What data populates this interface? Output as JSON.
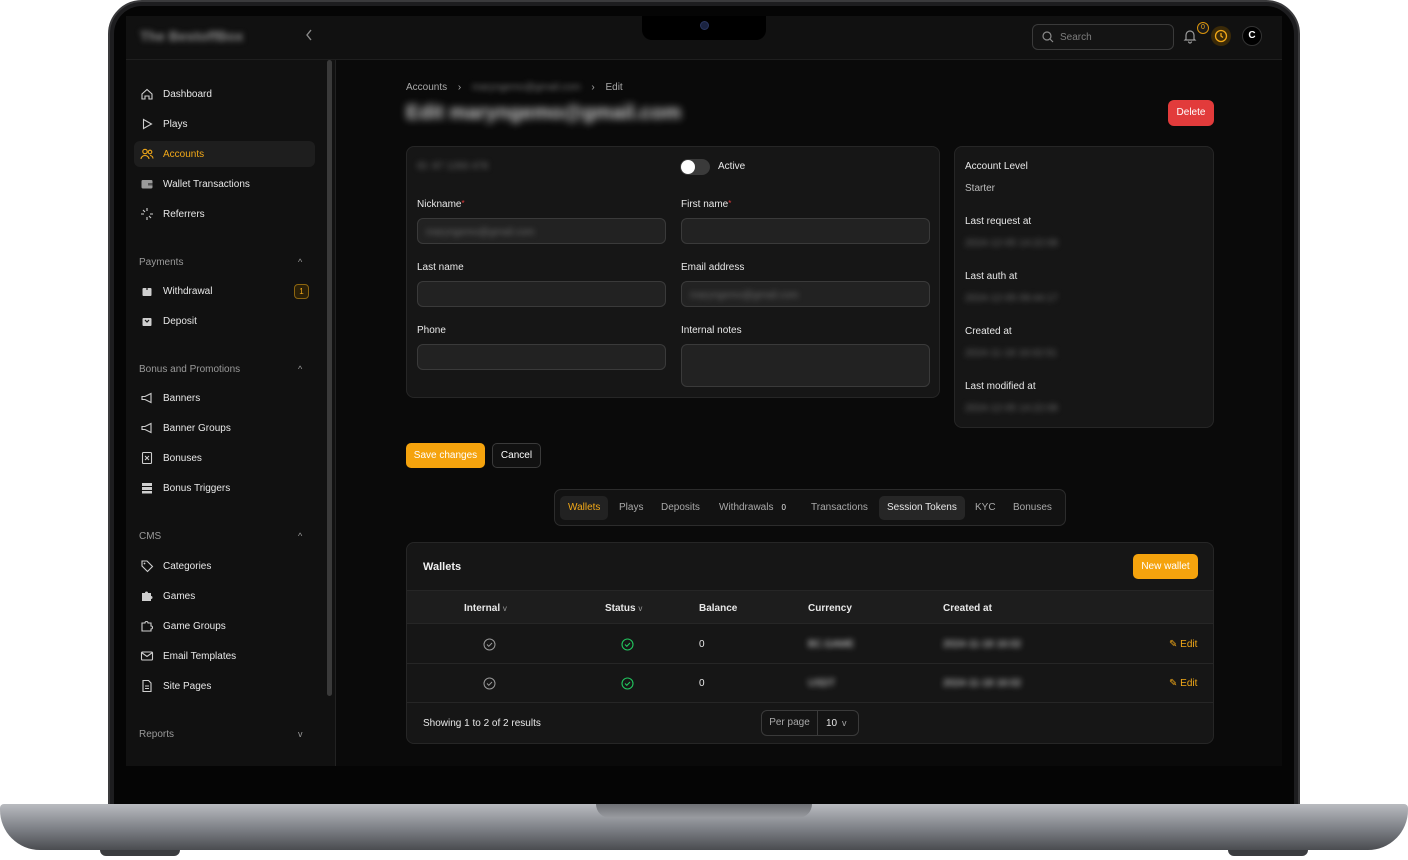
{
  "topbar": {
    "brand": "The BestoffBox",
    "search_placeholder": "Search",
    "notifications_count": "0",
    "avatar_initial": "C"
  },
  "sidebar": {
    "items": [
      {
        "label": "Dashboard",
        "icon": "home-icon"
      },
      {
        "label": "Plays",
        "icon": "play-icon"
      },
      {
        "label": "Accounts",
        "icon": "users-icon",
        "active": true
      },
      {
        "label": "Wallet Transactions",
        "icon": "wallet-icon"
      },
      {
        "label": "Referrers",
        "icon": "sparkle-icon"
      }
    ],
    "groups": [
      {
        "label": "Payments",
        "items": [
          {
            "label": "Withdrawal",
            "icon": "withdraw-icon",
            "badge": "1"
          },
          {
            "label": "Deposit",
            "icon": "deposit-icon"
          }
        ]
      },
      {
        "label": "Bonus and Promotions",
        "items": [
          {
            "label": "Banners",
            "icon": "megaphone-icon"
          },
          {
            "label": "Banner Groups",
            "icon": "megaphone-icon"
          },
          {
            "label": "Bonuses",
            "icon": "bonus-icon"
          },
          {
            "label": "Bonus Triggers",
            "icon": "stack-icon"
          }
        ]
      },
      {
        "label": "CMS",
        "items": [
          {
            "label": "Categories",
            "icon": "tag-icon"
          },
          {
            "label": "Games",
            "icon": "puzzle-icon"
          },
          {
            "label": "Game Groups",
            "icon": "puzzle-icon"
          },
          {
            "label": "Email Templates",
            "icon": "mail-icon"
          },
          {
            "label": "Site Pages",
            "icon": "document-icon"
          }
        ]
      },
      {
        "label": "Reports",
        "items": []
      }
    ]
  },
  "breadcrumb": {
    "root": "Accounts",
    "middle": "maryngemo@gmail.com",
    "current": "Edit"
  },
  "page": {
    "title": "Edit maryngemo@gmail.com",
    "delete_label": "Delete"
  },
  "form": {
    "id_text": "ID: 87 1283 478",
    "active_label": "Active",
    "nickname_label": "Nickname",
    "nickname_value": "maryngemo@gmail.com",
    "firstname_label": "First name",
    "lastname_label": "Last name",
    "email_label": "Email address",
    "email_value": "maryngemo@gmail.com",
    "phone_label": "Phone",
    "notes_label": "Internal notes",
    "save_label": "Save changes",
    "cancel_label": "Cancel"
  },
  "info": {
    "level_label": "Account Level",
    "level_value": "Starter",
    "last_request_label": "Last request at",
    "last_request_value": "2024-12-05 14:22:08",
    "last_auth_label": "Last auth at",
    "last_auth_value": "2024-12-05 09:44:17",
    "created_label": "Created at",
    "created_value": "2024-11-18 16:02:51",
    "modified_label": "Last modified at",
    "modified_value": "2024-12-05 14:22:08"
  },
  "tabs": [
    {
      "label": "Wallets",
      "active": true
    },
    {
      "label": "Plays"
    },
    {
      "label": "Deposits"
    },
    {
      "label": "Withdrawals",
      "count": "0"
    },
    {
      "label": "Transactions"
    },
    {
      "label": "Session Tokens",
      "highlight": true
    },
    {
      "label": "KYC"
    },
    {
      "label": "Bonuses"
    }
  ],
  "wallets": {
    "title": "Wallets",
    "new_label": "New wallet",
    "columns": [
      "Internal",
      "Status",
      "Balance",
      "Currency",
      "Created at"
    ],
    "rows": [
      {
        "balance": "0",
        "currency": "BC.GAME",
        "created": "2024-11-18 16:02",
        "edit": "Edit"
      },
      {
        "balance": "0",
        "currency": "USDT",
        "created": "2024-11-18 16:02",
        "edit": "Edit"
      }
    ],
    "footer": "Showing 1 to 2 of 2 results",
    "per_page_label": "Per page",
    "per_page_value": "10"
  },
  "colors": {
    "accent": "#f5a30d",
    "danger": "#e23b3b",
    "success": "#22c55e",
    "background": "#0a0a0a"
  }
}
